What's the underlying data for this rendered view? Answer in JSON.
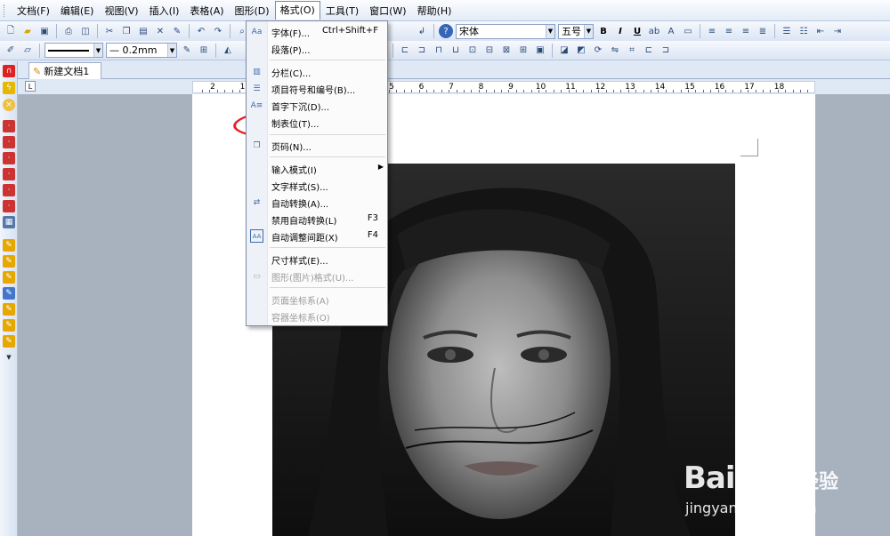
{
  "menubar": {
    "items": [
      "文档(F)",
      "编辑(E)",
      "视图(V)",
      "插入(I)",
      "表格(A)",
      "图形(D)",
      "格式(O)",
      "工具(T)",
      "窗口(W)",
      "帮助(H)"
    ],
    "active_index": 6
  },
  "toolbar": {
    "font_name": "宋体",
    "font_size": "五号",
    "line_width": "0.2mm"
  },
  "tab": {
    "label": "新建文档1"
  },
  "ruler": {
    "numbers": [
      "2",
      "1",
      "1",
      "2",
      "3",
      "4",
      "5",
      "6",
      "7",
      "8",
      "9",
      "10",
      "11",
      "12",
      "13",
      "14",
      "15",
      "16",
      "17",
      "18"
    ]
  },
  "format_menu": {
    "items": [
      {
        "label": "字体(F)...",
        "shortcut": "Ctrl+Shift+F",
        "icon": "font-icon"
      },
      {
        "label": "段落(P)...",
        "shortcut": "",
        "icon": ""
      },
      {
        "label": "分栏(C)...",
        "shortcut": "",
        "icon": "columns-icon"
      },
      {
        "label": "项目符号和编号(B)...",
        "shortcut": "",
        "icon": "list-icon"
      },
      {
        "label": "首字下沉(D)...",
        "shortcut": "",
        "icon": "dropcap-icon"
      },
      {
        "label": "制表位(T)...",
        "shortcut": "",
        "icon": ""
      },
      {
        "label": "页码(N)...",
        "shortcut": "",
        "icon": "page-number-icon"
      },
      {
        "label": "输入模式(I)",
        "shortcut": "▶",
        "icon": ""
      },
      {
        "label": "文字样式(S)...",
        "shortcut": "",
        "icon": ""
      },
      {
        "label": "自动转换(A)...",
        "shortcut": "",
        "icon": "auto-convert-icon"
      },
      {
        "label": "禁用自动转换(L)",
        "shortcut": "F3",
        "icon": ""
      },
      {
        "label": "自动调整间距(X)",
        "shortcut": "F4",
        "icon": "spacing-icon"
      },
      {
        "label": "尺寸样式(E)...",
        "shortcut": "",
        "icon": ""
      },
      {
        "label": "图形(图片)格式(U)...",
        "shortcut": "",
        "icon": "image-format-icon"
      },
      {
        "label": "页面坐标系(A)",
        "shortcut": "",
        "icon": ""
      },
      {
        "label": "容器坐标系(O)",
        "shortcut": "",
        "icon": ""
      }
    ]
  },
  "watermark": {
    "logo": "Bai du",
    "cn": "经验",
    "url": "jingyan.baidu.com"
  },
  "colors": {
    "highlight_ellipse": "#e8202a",
    "menu_bg": "#fbfbfb"
  }
}
